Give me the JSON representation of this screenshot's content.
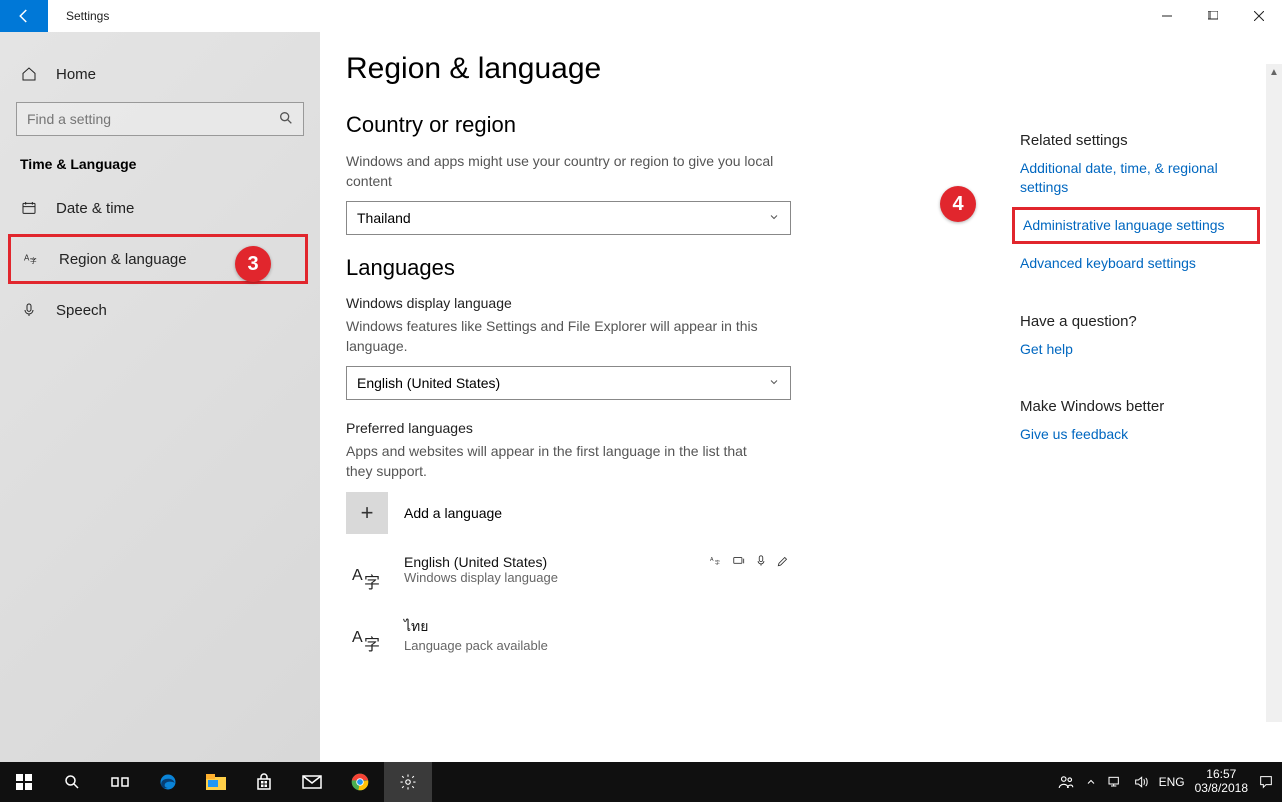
{
  "window": {
    "app_title": "Settings"
  },
  "sidebar": {
    "home": "Home",
    "search_placeholder": "Find a setting",
    "category": "Time & Language",
    "items": [
      {
        "label": "Date & time"
      },
      {
        "label": "Region & language"
      },
      {
        "label": "Speech"
      }
    ]
  },
  "page": {
    "title": "Region & language",
    "country_section": "Country or region",
    "country_desc": "Windows and apps might use your country or region to give you local content",
    "country_value": "Thailand",
    "languages_section": "Languages",
    "display_lang_label": "Windows display language",
    "display_lang_desc": "Windows features like Settings and File Explorer will appear in this language.",
    "display_lang_value": "English (United States)",
    "preferred_label": "Preferred languages",
    "preferred_desc": "Apps and websites will appear in the first language in the list that they support.",
    "add_language": "Add a language",
    "langs": [
      {
        "name": "English (United States)",
        "sub": "Windows display language"
      },
      {
        "name": "ไทย",
        "sub": "Language pack available"
      }
    ]
  },
  "rail": {
    "related_hdr": "Related settings",
    "link_additional": "Additional date, time, & regional settings",
    "link_admin": "Administrative language settings",
    "link_keyboard": "Advanced keyboard settings",
    "question_hdr": "Have a question?",
    "link_help": "Get help",
    "better_hdr": "Make Windows better",
    "link_feedback": "Give us feedback"
  },
  "callouts": {
    "c3": "3",
    "c4": "4"
  },
  "taskbar": {
    "lang": "ENG",
    "time": "16:57",
    "date": "03/8/2018"
  }
}
